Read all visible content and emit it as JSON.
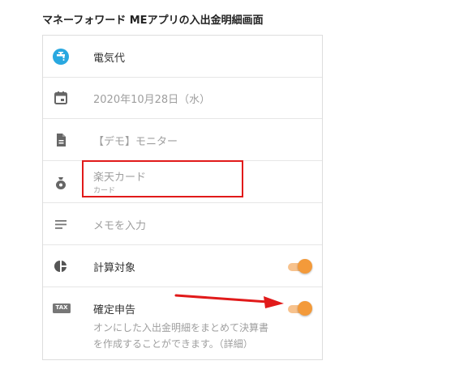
{
  "caption": "マネーフォワード MEアプリの入出金明細画面",
  "rows": [
    {
      "icon": "faucet-icon",
      "label": "電気代"
    },
    {
      "icon": "calendar-icon",
      "label": "2020年10月28日（水）"
    },
    {
      "icon": "document-icon",
      "label": "【デモ】モニター"
    },
    {
      "icon": "money-bag-icon",
      "label": "楽天カード",
      "sublabel": "カード"
    },
    {
      "icon": "notes-icon",
      "placeholder": "メモを入力"
    },
    {
      "icon": "pie-chart-icon",
      "label": "計算対象",
      "toggle_on": true
    },
    {
      "icon": "tax-icon",
      "icon_text": "TAX",
      "label": "確定申告",
      "toggle_on": true,
      "description_line1": "オンにした入出金明細をまとめて決算書",
      "description_line2": "を作成することができます。（詳細）"
    }
  ],
  "colors": {
    "accent_orange": "#f39a3a",
    "accent_orange_track": "#f7c28d",
    "highlight_red": "#e11a1a",
    "faucet_blue": "#29a8e0"
  }
}
